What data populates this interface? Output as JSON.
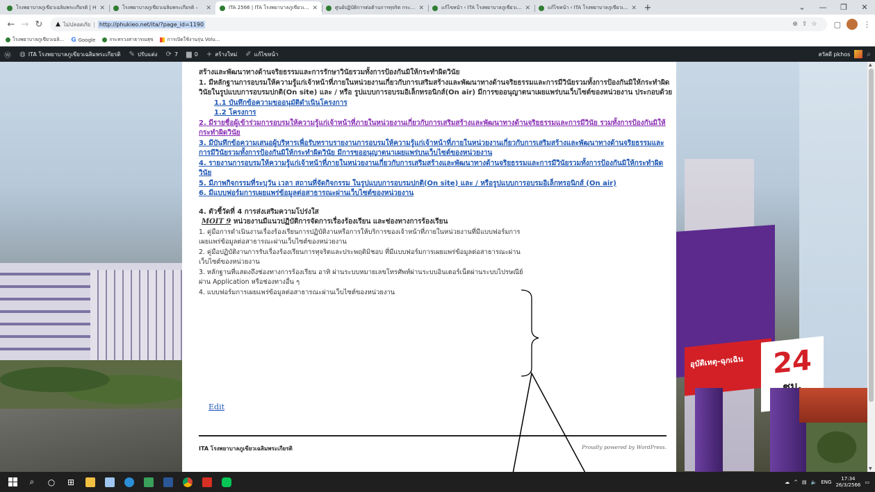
{
  "browser": {
    "tabs": [
      {
        "title": "โรงพยาบาลภูเขียวเฉลิมพระเกียรติ | H",
        "active": false
      },
      {
        "title": "โรงพยาบาลภูเขียวเฉลิมพระเกียรติ – ",
        "active": false
      },
      {
        "title": "ITA 2566 | ITA โรงพยาบาลภูเขียวเฉลิ",
        "active": true
      },
      {
        "title": "ศูนย์ปฏิบัติการต่อต้านการทุจริต กระทรวง",
        "active": false
      },
      {
        "title": "แก้ไขหน้า ‹ ITA โรงพยาบาลภูเขียวเฉลิ",
        "active": false
      },
      {
        "title": "แก้ไขหน้า ‹ ITA โรงพยาบาลภูเขียวเฉลิ",
        "active": false
      }
    ],
    "close_glyph": "✕",
    "new_tab_glyph": "+",
    "window_controls": [
      "⌄",
      "—",
      "❐",
      "✕"
    ],
    "security_label": "ไม่ปลอดภัย",
    "url": "http://phukieo.net/ita/?page_id=1190",
    "bookmarks": [
      "โรงพยาบาลภูเขียวเฉลิ...",
      "Google",
      "กระทรวงสาธารณสุข",
      "การเปิดใช้งานรุ่น Volu..."
    ]
  },
  "adminbar": {
    "site_name": "ITA โรงพยาบาลภูเขียวเฉลิมพระเกียรติ",
    "customize": "ปรับแต่ง",
    "updates": "7",
    "comments": "0",
    "new": "สร้างใหม่",
    "edit": "แก้ไขหน้า",
    "greeting": "สวัสดี pkhos"
  },
  "content": {
    "intro": "สร้างและพัฒนาทางด้านจริยธรรมและการรักษาวินัยรวมทั้งการป้องกันมิให้กระทำผิดวินัย",
    "item1": "1. มีหลักฐานการอบรมให้ความรู้แก่เจ้าหน้าที่ภายในหน่วยงานเกี่ยวกับการเสริมสร้างและพัฒนาทางด้านจริยธรรมและการมีวินัยรวมทั้งการป้องกันมิให้กระทำผิดวินัยในรูปแบบการอบรมปกติ(On site) และ / หรือ รูปแบบการอบรมอิเล็กทรอนิกส์(On air) มีการขออนุญาตนาเผยแพร่บนเว็บไซต์ของหน่วยงาน ประกอบด้วย",
    "sub1": "1.1 บันทึกข้อความขออนุมัติดำเนินโครงการ",
    "sub2": "1.2 โครงการ",
    "link2": "2. มีรายชื่อผู้เข้าร่วมการอบรมให้ความรู้แก่เจ้าหน้าที่ภายในหน่วยงานเกี่ยวกับการเสริมสร้างและพัฒนาทางด้านจริยธรรมและการมีวินัย รวมทั้งการป้องกันมิให้กระทำผิดวินัย",
    "link3": "3. มีบันทึกข้อความเสนอผู้บริหารเพื่อรับทราบรายงานการอบรมให้ความรู้แก่เจ้าหน้าที่ภายในหน่วยงานเกี่ยวกับการเสริมสร้างและพัฒนาทางด้านจริยธรรมและการมีวินัยรวมทั้งการป้องกันมิให้กระทำผิดวินัย มีการขออนุญาตนาเผยแพร่บนเว็บไซต์ของหน่วยงาน",
    "link4": "4. รายงานการอบรมให้ความรู้แก่เจ้าหน้าที่ภายในหน่วยงานเกี่ยวกับการเสริมสร้างและพัฒนาทางด้านจริยธรรมและการมีวินัยรวมทั้งการป้องกันมิให้กระทำผิดวินัย",
    "link5": "5. มีภาพกิจกรรมที่ระบุวัน เวลา สถานที่จัดกิจกรรม ในรูปแบบการอบรมปกติ(On site) และ / หรือรูปแบบการอบรมอิเล็กทรอนิกส์ (On air)",
    "link6": "6. มีแบบฟอร์มการเผยแพร่ข้อมูลต่อสาธารณะผ่านเว็บไซต์ของหน่วยงาน",
    "indicator": "4. ตัวชี้วัดที่ 4 การส่งเสริมความโปร่งใส",
    "moit_tag": "MOIT 9",
    "moit_text": " หน่วยงานมีแนวปฏิบัติการจัดการเรื่องร้องเรียน และช่องทางการร้องเรียน",
    "p1": "1. คู่มือการดำเนินงานเรื่องร้องเรียนการปฏิบัติงานหรือการให้บริการของเจ้าหน้าที่ภายในหน่วยงานที่มีแบบฟอร์มการเผยแพร่ข้อมูลต่อสาธารณะผ่านเว็บไซต์ของหน่วยงาน",
    "p2": "2. คู่มือปฏิบัติงานการรับเรื่องร้องเรียนการทุจริตและประพฤติมิชอบ ที่มีแบบฟอร์มการเผยแพร่ข้อมูลต่อสาธารณะผ่านเว็บไซต์ของหน่วยงาน",
    "p3": "3. หลักฐานที่แสดงถึงช่องทางการร้องเรียน อาทิ ผ่านระบบหมายเลขโทรศัพท์ผ่านระบบอินเตอร์เน็ตผ่านระบบไปรษณีย์ ผ่าน Application หรือช่องทางอื่น ๆ",
    "p4": "4. แบบฟอร์มการเผยแพร่ข้อมูลต่อสาธารณะผ่านเว็บไซต์ของหน่วยงาน",
    "edit": "Edit"
  },
  "footer": {
    "site": "ITA โรงพยาบาลภูเขียวเฉลิมพระเกียรติ",
    "credit": "Proudly powered by WordPress."
  },
  "background_sign": {
    "emergency": "อุบัติเหตุ-ฉุกเฉิน",
    "hours": "24",
    "hours_unit": "ชม."
  },
  "taskbar": {
    "lang": "ENG",
    "time": "17:34",
    "date": "26/3/2566"
  },
  "colors": {
    "link": "#1f57b4",
    "visited": "#8a2fb4",
    "adminbar": "#1d2327"
  }
}
